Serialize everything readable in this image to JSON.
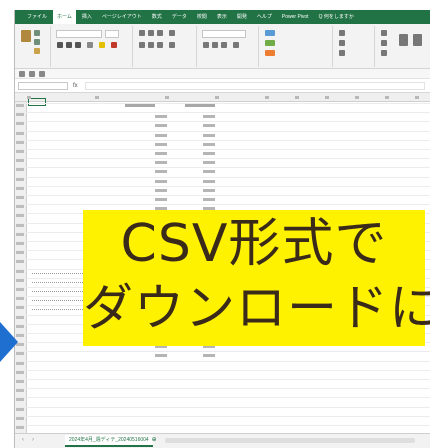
{
  "ribbon": {
    "tabs": [
      "ファイル",
      "ホーム",
      "挿入",
      "ページレイアウト",
      "数式",
      "データ",
      "校閲",
      "表示",
      "開発",
      "ヘルプ",
      "Power Pivot",
      "Q 何をしますか"
    ],
    "active_tab_index": 1
  },
  "banner": {
    "line1": "CSV形式で",
    "line2": "ダウンロードにも対応",
    "color": "#fff200"
  },
  "sheet_tab": {
    "label": "2024年4月_週ディテ_20240516004"
  },
  "accent_colors": {
    "excel_green": "#217346",
    "arrow_blue": "#1f6fd1"
  }
}
